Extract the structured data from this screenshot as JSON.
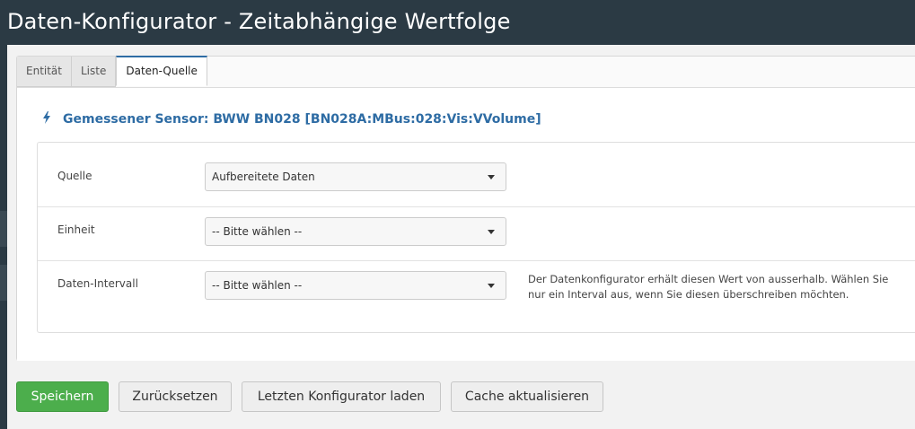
{
  "dialog": {
    "title": "Daten-Konfigurator - Zeitabhängige Wertfolge"
  },
  "tabs": [
    {
      "label": "Entität",
      "active": false
    },
    {
      "label": "Liste",
      "active": false
    },
    {
      "label": "Daten-Quelle",
      "active": true
    }
  ],
  "sensor": {
    "icon": "bolt-icon",
    "label": "Gemessener Sensor: BWW BN028 [BN028A:MBus:028:Vis:VVolume]"
  },
  "form": {
    "quelle": {
      "label": "Quelle",
      "value": "Aufbereitete Daten"
    },
    "einheit": {
      "label": "Einheit",
      "value": "-- Bitte wählen --"
    },
    "intervall": {
      "label": "Daten-Intervall",
      "value": "-- Bitte wählen --",
      "help": "Der Datenkonfigurator erhält diesen Wert von ausserhalb. Wählen Sie nur ein Interval aus, wenn Sie diesen überschreiben möchten."
    }
  },
  "buttons": {
    "save": "Speichern",
    "reset": "Zurücksetzen",
    "load_last": "Letzten Konfigurator laden",
    "refresh_cache": "Cache aktualisieren"
  },
  "colors": {
    "accent": "#2e6ca4",
    "primary_button": "#4cae4c",
    "background": "#2b3a44"
  }
}
